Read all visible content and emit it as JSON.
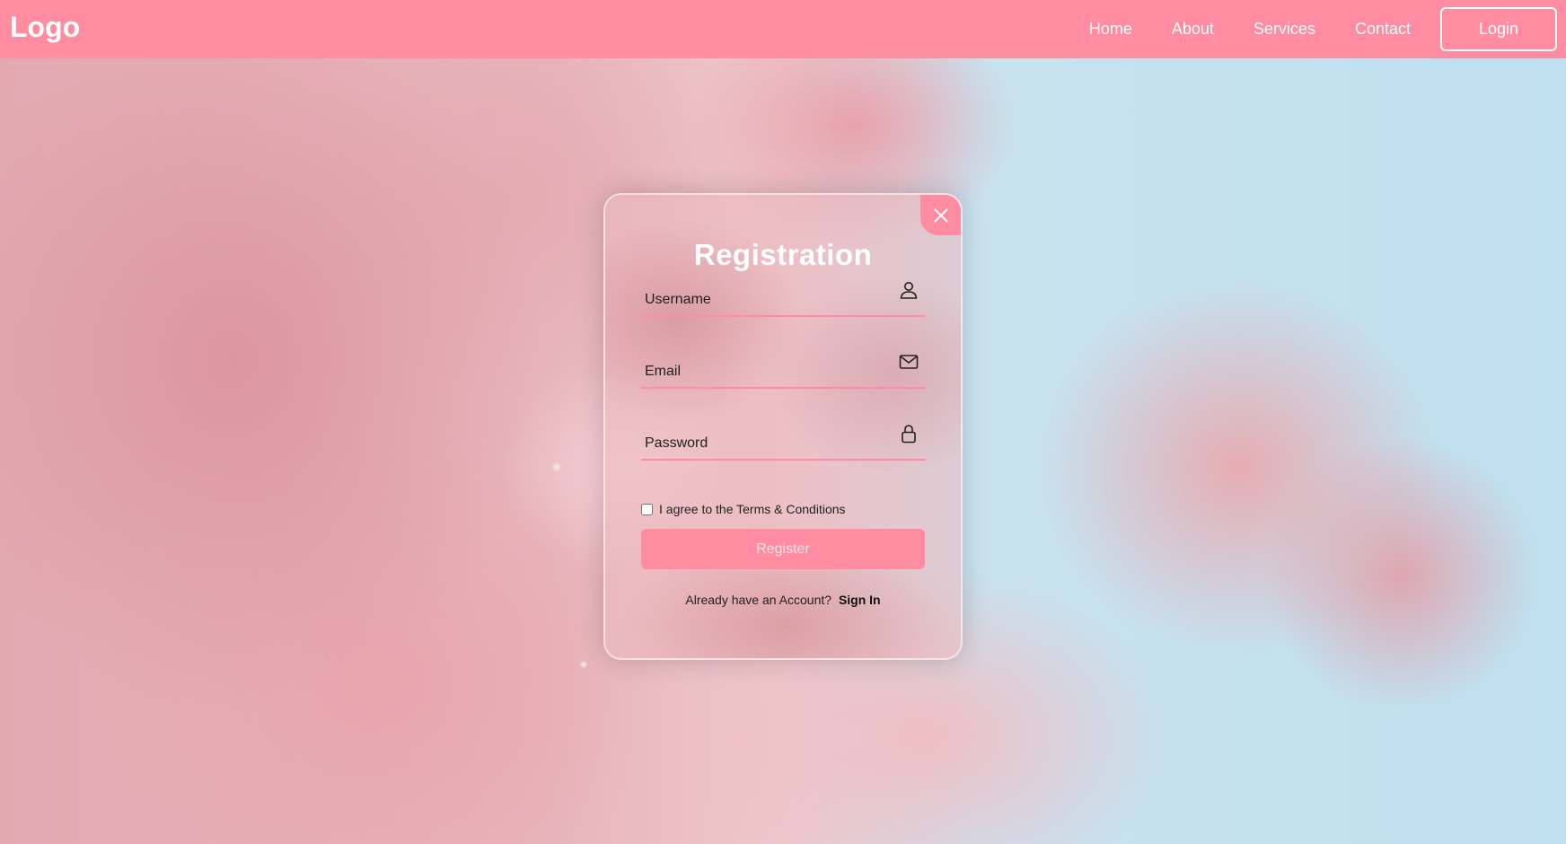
{
  "navbar": {
    "logo": "Logo",
    "links": [
      "Home",
      "About",
      "Services",
      "Contact"
    ],
    "login_label": "Login",
    "color": "#ff8ca1"
  },
  "registration": {
    "title": "Registration",
    "close_icon": "close-icon",
    "fields": [
      {
        "placeholder": "Username",
        "icon": "user-icon"
      },
      {
        "placeholder": "Email",
        "icon": "mail-icon"
      },
      {
        "placeholder": "Password",
        "icon": "lock-icon"
      }
    ],
    "terms_label": "I agree to the Terms & Conditions",
    "terms_checked": false,
    "register_label": "Register",
    "signin_prompt": "Already have an Account?",
    "signin_link": "Sign In",
    "accent": "#ff8ca1"
  }
}
